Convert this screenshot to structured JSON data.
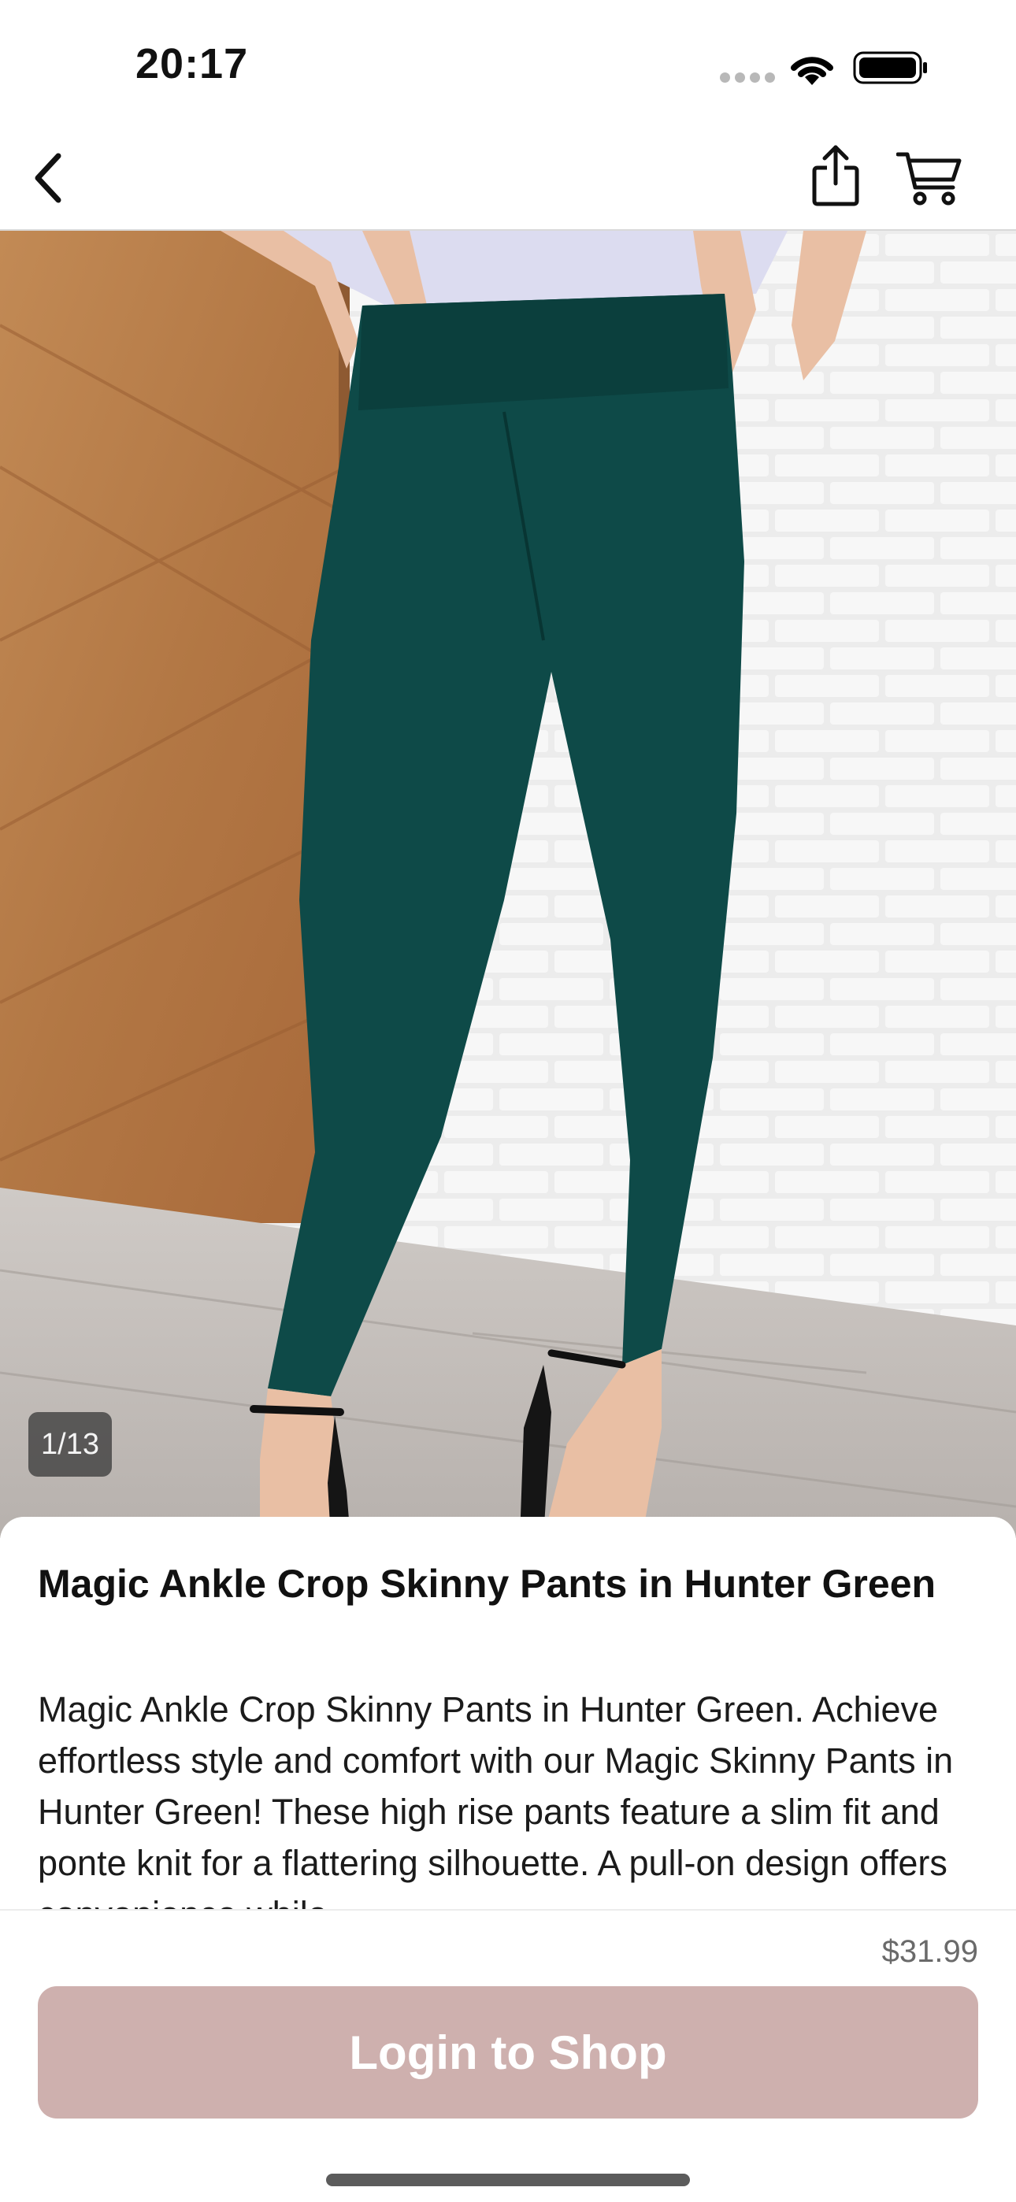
{
  "status_bar": {
    "time": "20:17"
  },
  "nav": {
    "icons": [
      "chevron-left-icon",
      "share-icon",
      "cart-icon"
    ]
  },
  "gallery": {
    "counter": "1/13"
  },
  "product": {
    "title": "Magic Ankle Crop Skinny Pants in Hunter Green",
    "description": "Magic Ankle Crop Skinny Pants in Hunter Green. Achieve effortless style and comfort with our Magic Skinny Pants in Hunter Green! These high rise pants feature a slim fit and ponte knit for a flattering silhouette. A pull-on design offers convenience while",
    "price": "$31.99"
  },
  "actions": {
    "login_label": "Login to Shop"
  },
  "colors": {
    "button": "#ceb0ae",
    "pants": "#0e4a48"
  }
}
